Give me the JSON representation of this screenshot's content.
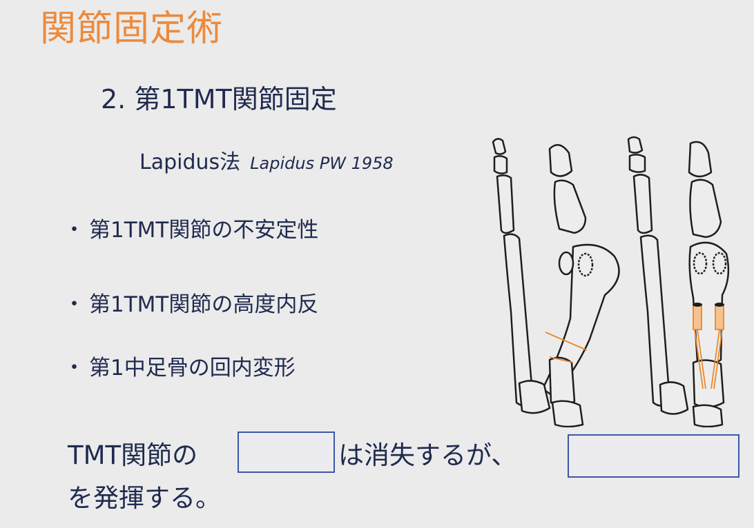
{
  "title": "関節固定術",
  "subtitle": "2. 第1TMT関節固定",
  "method": {
    "name": "Lapidus法",
    "reference": "Lapidus PW 1958"
  },
  "bullets": [
    {
      "marker": "・",
      "text": "第1TMT関節の不安定性"
    },
    {
      "marker": "・",
      "text": "第1TMT関節の高度内反"
    },
    {
      "marker": "・",
      "text": "第1中足骨の回内変形"
    }
  ],
  "conclusion": {
    "part1": "TMT関節の",
    "part2": "は消失するが、",
    "part3": "を発揮する。"
  },
  "colors": {
    "title": "#ec8a3c",
    "text": "#1f2a4e",
    "blank_border": "#3a56a6",
    "implant": "#e8892d"
  }
}
